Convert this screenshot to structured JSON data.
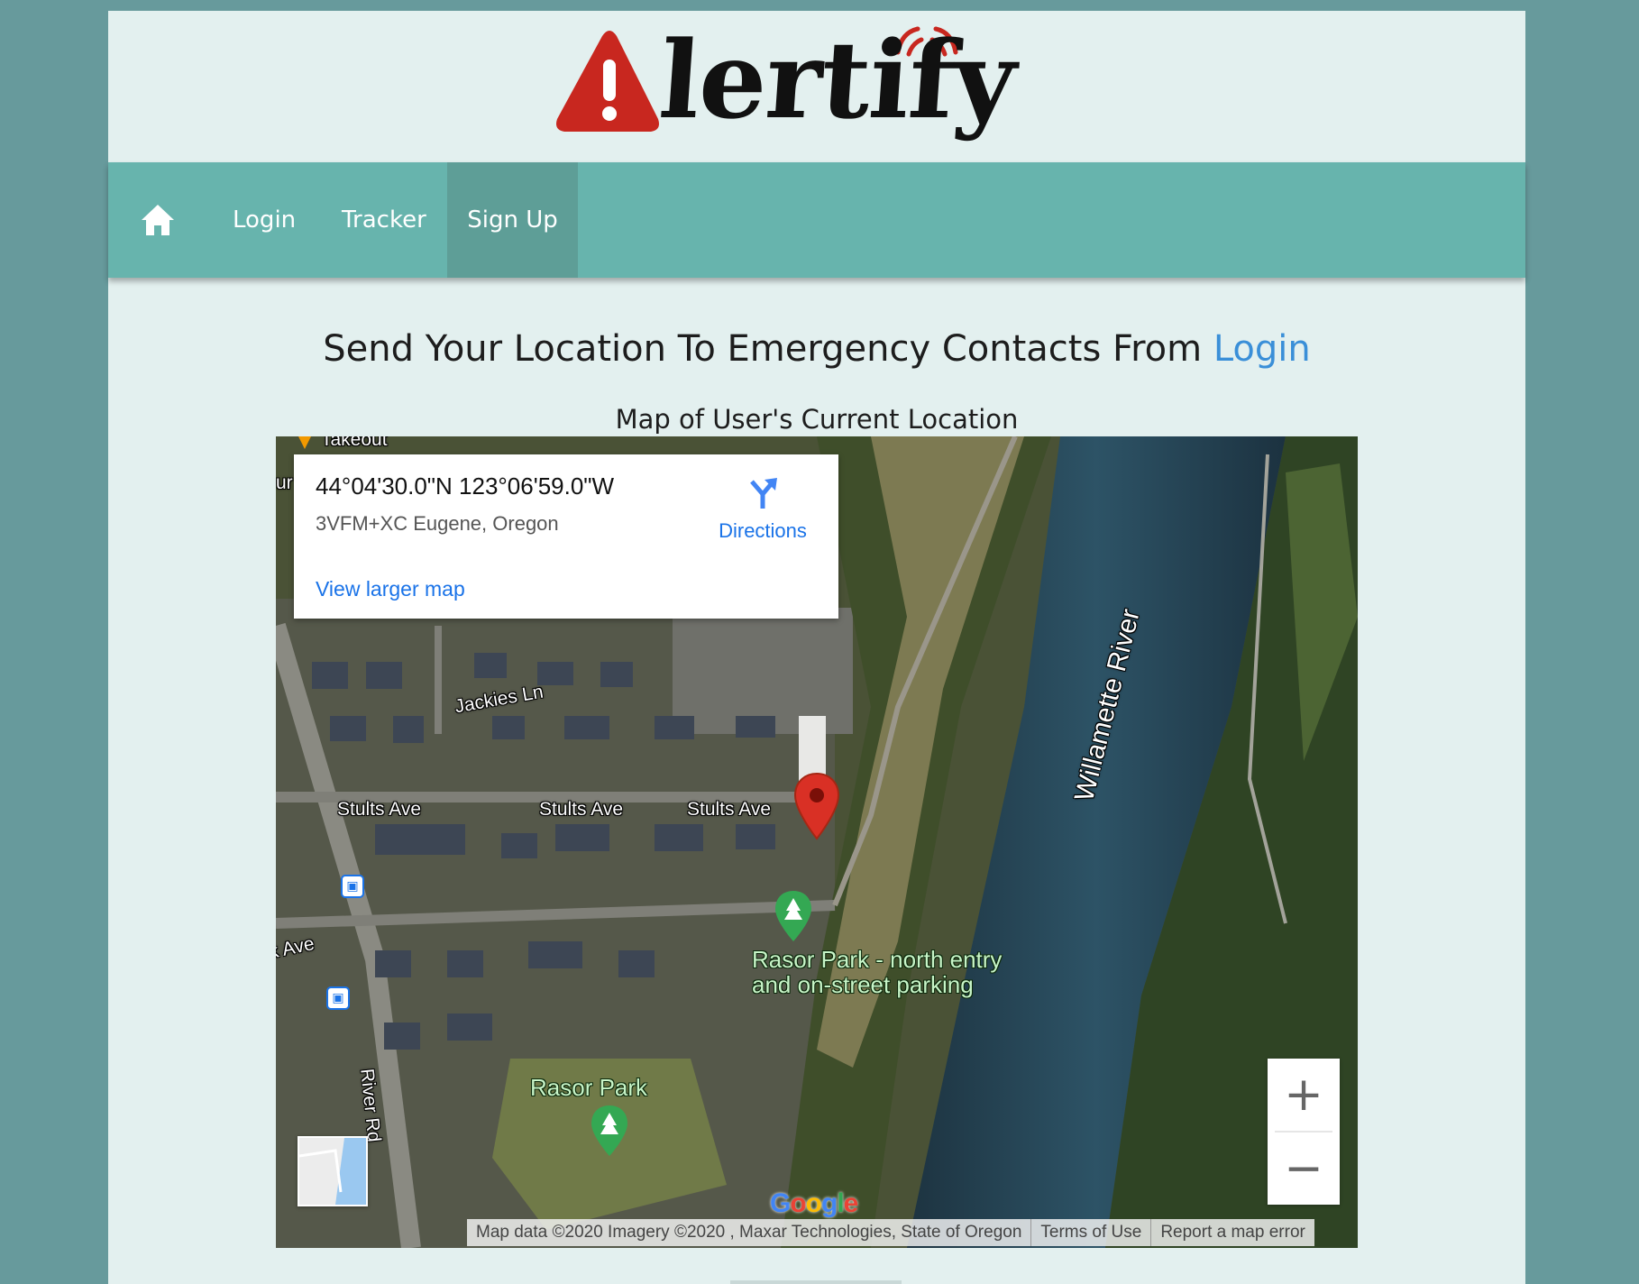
{
  "brand": {
    "logo_text": "lertify",
    "logo_alt": "Alertify"
  },
  "nav": {
    "home_icon": "home-icon",
    "items": [
      {
        "label": "Login"
      },
      {
        "label": "Tracker"
      },
      {
        "label": "Sign Up",
        "active": true
      }
    ]
  },
  "headline": {
    "text": "Send Your Location To Emergency Contacts From ",
    "link_label": "Login"
  },
  "map_heading": "Map of User's Current Location",
  "map": {
    "info_card": {
      "coordinates": "44°04'30.0\"N 123°06'59.0\"W",
      "plus_code": "3VFM+XC Eugene, Oregon",
      "directions_label": "Directions",
      "larger_map_label": "View larger map"
    },
    "labels": {
      "takeout": "Takeout",
      "jackies_ln": "Jackies Ln",
      "stults_1": "Stults Ave",
      "stults_2": "Stults Ave",
      "stults_3": "Stults Ave",
      "ave_partial": "k Ave",
      "river_rd": "River Rd",
      "river": "Willamette River",
      "park_north": "Rasor Park - north entry\nand on-street parking",
      "park_north_l1": "Rasor Park - north entry",
      "park_north_l2": "and on-street parking",
      "park": "Rasor Park",
      "partial_left": "ur"
    },
    "zoom": {
      "in_label": "+",
      "out_label": "−"
    },
    "google": "Google",
    "attribution": {
      "data": "Map data ©2020 Imagery ©2020 , Maxar Technologies, State of Oregon",
      "terms": "Terms of Use",
      "report": "Report a map error"
    },
    "colors": {
      "pin": "#d93025",
      "park_pin": "#34a853",
      "link": "#1a73e8"
    }
  },
  "colors": {
    "background": "#679a9c",
    "page": "#e3f0ef",
    "navbar": "#67b4ad",
    "nav_active": "#5e9e97",
    "headline_link": "#3a8fd8",
    "logo_red": "#c8271f"
  }
}
